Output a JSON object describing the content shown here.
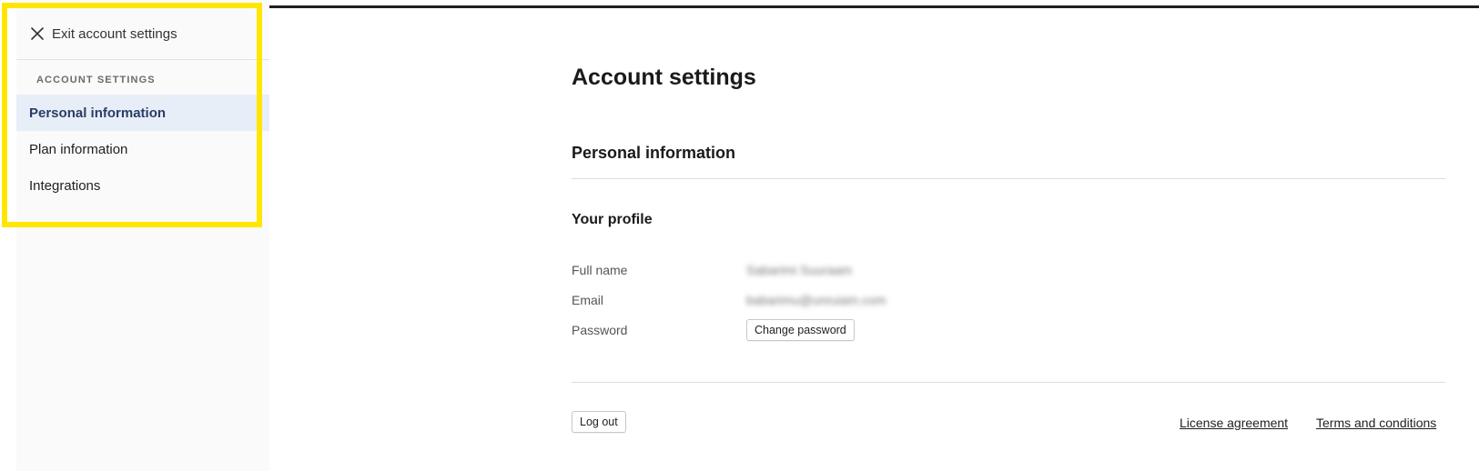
{
  "sidebar": {
    "exit_label": "Exit account settings",
    "section_heading": "ACCOUNT SETTINGS",
    "items": [
      {
        "label": "Personal information",
        "active": true
      },
      {
        "label": "Plan information",
        "active": false
      },
      {
        "label": "Integrations",
        "active": false
      }
    ]
  },
  "main": {
    "page_title": "Account settings",
    "section_title": "Personal information",
    "profile": {
      "title": "Your profile",
      "fields": [
        {
          "label": "Full name",
          "value": "Sabarimi Suuraam"
        },
        {
          "label": "Email",
          "value": "babarimu@unruiam.com"
        },
        {
          "label": "Password",
          "button_label": "Change password"
        }
      ]
    },
    "logout_label": "Log out",
    "footer_links": [
      "License agreement",
      "Terms and conditions"
    ]
  },
  "icons": {
    "exit": "close-icon"
  },
  "colors": {
    "highlight_frame": "#ffe600",
    "active_item_bg": "#e8eef7",
    "active_item_text": "#2a3d66"
  }
}
